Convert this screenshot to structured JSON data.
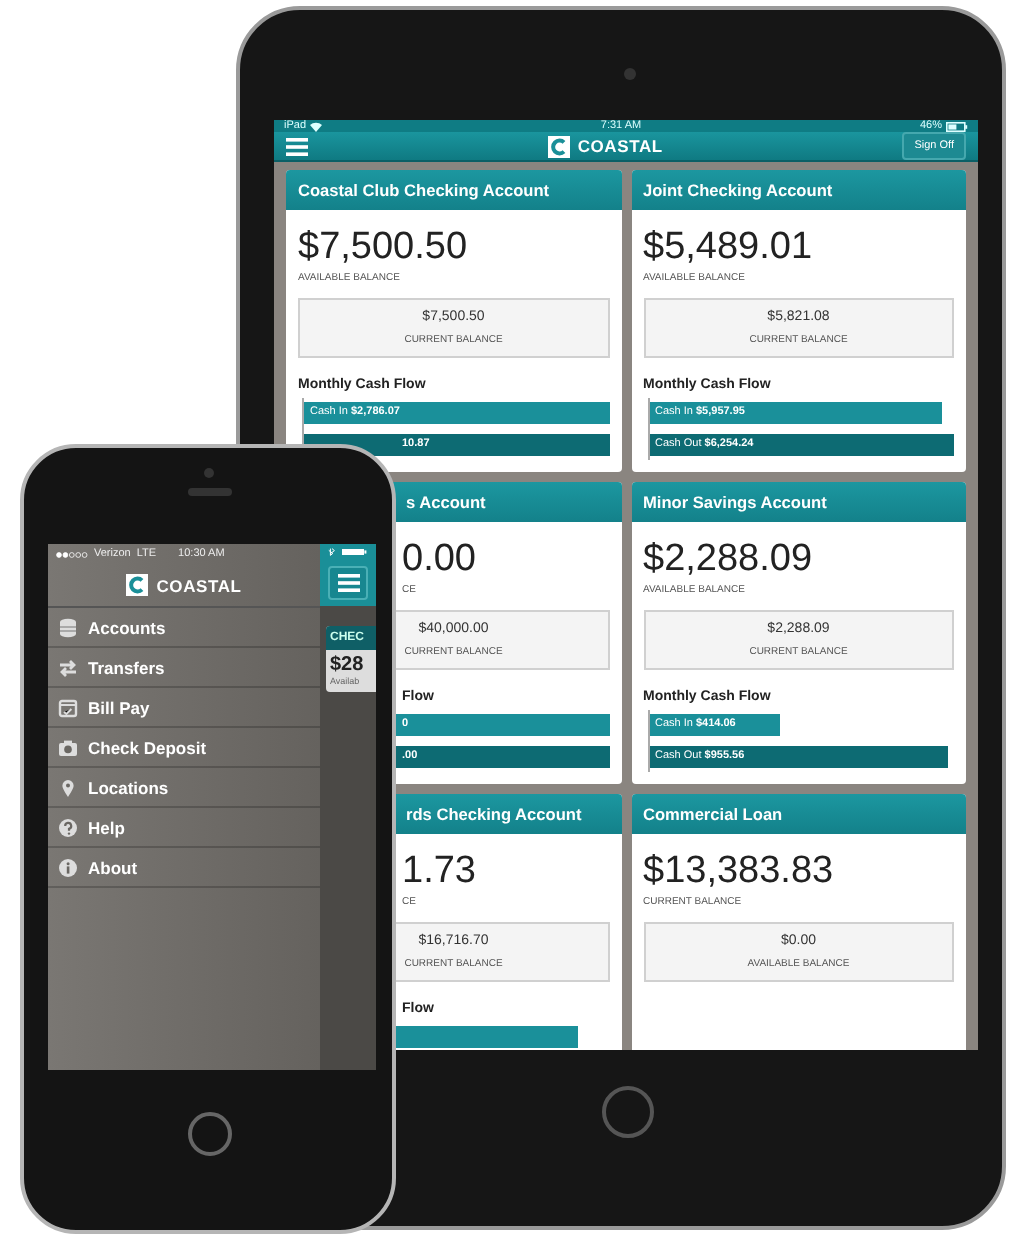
{
  "tablet": {
    "status_bar": {
      "device": "iPad",
      "time": "7:31 AM",
      "battery": "46%"
    },
    "header": {
      "brand": "COASTAL",
      "sign_off": "Sign Off"
    },
    "cards": [
      {
        "title": "Coastal Club Checking Account",
        "occluded": false,
        "amount": "$7,500.50",
        "amount_label": "AVAILABLE BALANCE",
        "box_amount": "$7,500.50",
        "box_label": "CURRENT BALANCE",
        "flow_title": "Monthly Cash Flow",
        "bars": [
          {
            "kind": "in",
            "occluded": false,
            "label": "Cash In",
            "value": "$2,786.07",
            "level": 1.0
          },
          {
            "kind": "out",
            "occluded": true,
            "value": "10.87",
            "level": 1.0
          }
        ]
      },
      {
        "title": "Joint Checking Account",
        "occluded": false,
        "amount": "$5,489.01",
        "amount_label": "AVAILABLE BALANCE",
        "box_amount": "$5,821.08",
        "box_label": "CURRENT BALANCE",
        "flow_title": "Monthly Cash Flow",
        "bars": [
          {
            "kind": "in",
            "occluded": false,
            "label": "Cash In",
            "value": "$5,957.95",
            "level": 0.96
          },
          {
            "kind": "out",
            "occluded": false,
            "label": "Cash Out",
            "value": "$6,254.24",
            "level": 1.0
          }
        ]
      },
      {
        "title": "s Account",
        "occluded": true,
        "amount": "0.00",
        "amount_label": "CE",
        "box_amount": "$40,000.00",
        "box_label": "CURRENT BALANCE",
        "flow_title": "Flow",
        "bars": [
          {
            "kind": "in",
            "occluded": true,
            "value": "0",
            "level": 1.0
          },
          {
            "kind": "out",
            "occluded": true,
            "value": ".00",
            "level": 1.0
          }
        ]
      },
      {
        "title": "Minor Savings Account",
        "occluded": false,
        "amount": "$2,288.09",
        "amount_label": "AVAILABLE BALANCE",
        "box_amount": "$2,288.09",
        "box_label": "CURRENT BALANCE",
        "flow_title": "Monthly Cash Flow",
        "bars": [
          {
            "kind": "in",
            "occluded": false,
            "label": "Cash In",
            "value": "$414.06",
            "level": 0.43
          },
          {
            "kind": "out",
            "occluded": false,
            "label": "Cash Out",
            "value": "$955.56",
            "level": 0.98
          }
        ]
      },
      {
        "title": "rds Checking Account",
        "occluded": true,
        "amount": "1.73",
        "amount_label": "CE",
        "box_amount": "$16,716.70",
        "box_label": "CURRENT BALANCE",
        "flow_title": "Flow",
        "bars": [
          {
            "kind": "in",
            "level": 0.9
          }
        ]
      },
      {
        "title": "Commercial Loan",
        "occluded": false,
        "amount": "$13,383.83",
        "amount_label": "CURRENT BALANCE",
        "box_amount": "$0.00",
        "box_label": "AVAILABLE BALANCE"
      }
    ]
  },
  "phone": {
    "status_bar": {
      "carrier": "Verizon",
      "network": "LTE",
      "time": "10:30 AM"
    },
    "brand": "COASTAL",
    "menu": [
      {
        "label": "Accounts"
      },
      {
        "label": "Transfers"
      },
      {
        "label": "Bill Pay"
      },
      {
        "label": "Check Deposit"
      },
      {
        "label": "Locations"
      },
      {
        "label": "Help"
      },
      {
        "label": "About"
      }
    ],
    "peek_card": {
      "title": "CHEC",
      "amount": "$28",
      "label": "Availab"
    }
  }
}
